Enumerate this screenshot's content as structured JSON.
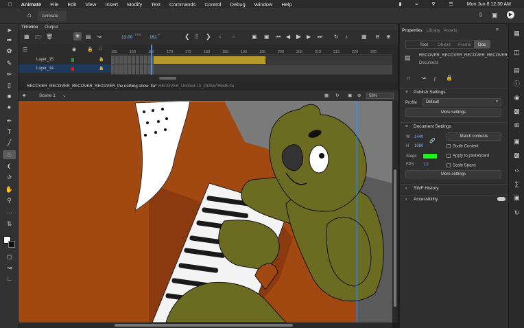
{
  "menubar": {
    "app": "Animate",
    "items": [
      "File",
      "Edit",
      "View",
      "Insert",
      "Modify",
      "Text",
      "Commands",
      "Control",
      "Debug",
      "Window",
      "Help"
    ],
    "clock": "Mon Jun 8  12:30 AM"
  },
  "toolbar": {
    "workspace_tab": "Animate"
  },
  "timeline": {
    "tabs": [
      "Timeline",
      "Output"
    ],
    "fps": "12.00",
    "fps_unit": "FPS",
    "frame": "191",
    "frame_unit": "F",
    "ruler": [
      "155",
      "160",
      "165",
      "170",
      "175",
      "180",
      "185",
      "190",
      "195",
      "200",
      "205",
      "210",
      "215",
      "220",
      "225",
      "230",
      "235",
      "240",
      "245"
    ],
    "layers": [
      {
        "name": "Layer_15",
        "color": "#2a9d2a"
      },
      {
        "name": "Layer_14",
        "color": "#d02020"
      }
    ]
  },
  "doc_tabs": [
    "RECOVER_RECOVER_RECOVER_RECOVER_the nothing show .fla*",
    "RECOVER_Untitled-10_20256735645.fla"
  ],
  "scene": {
    "label": "Scene 1",
    "zoom": "58%"
  },
  "properties": {
    "tabs": [
      "Properties",
      "Library",
      "Assets"
    ],
    "subtabs": [
      "Tool",
      "Object",
      "Frame",
      "Doc"
    ],
    "doc_name": "RECOVER_RECOVER_RECOVER_RECOVER_...",
    "doc_type": "Document",
    "publish": {
      "header": "Publish Settings",
      "profile_label": "Profile",
      "profile": "Default",
      "more": "More settings"
    },
    "document": {
      "header": "Document Settings",
      "w_label": "W",
      "w": "1440",
      "h_label": "H",
      "h": "1080",
      "match": "Match contents",
      "scale_content": "Scale Content",
      "apply_pasteboard": "Apply to pasteboard",
      "scale_spans": "Scale Spans",
      "stage_label": "Stage",
      "stage_color": "#22ee22",
      "fps_label": "FPS",
      "fps": "12",
      "more": "More settings"
    },
    "swf": "SWF History",
    "access": "Accessibility"
  },
  "colors": {
    "stage": "#a24811",
    "bear": "#6b6b22",
    "accent": "#4a90e2"
  }
}
